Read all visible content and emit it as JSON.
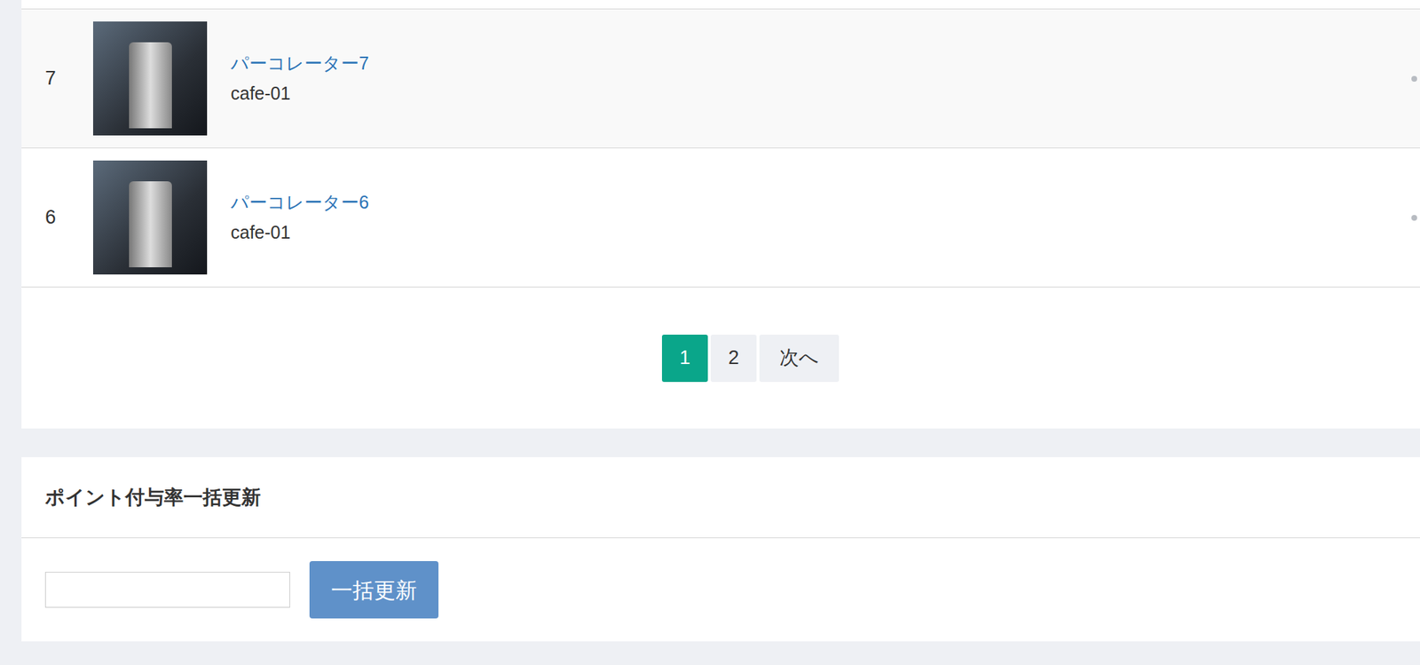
{
  "rows": [
    {
      "number": "7",
      "name": "パーコレーター7",
      "code": "cafe-01",
      "hovered": true
    },
    {
      "number": "6",
      "name": "パーコレーター6",
      "code": "cafe-01",
      "hovered": false
    }
  ],
  "pagination": {
    "pages": [
      {
        "label": "1",
        "selected": true
      },
      {
        "label": "2",
        "selected": false
      }
    ],
    "next": "次へ"
  },
  "bulk_update": {
    "title": "ポイント付与率一括更新",
    "input_value": "",
    "button": "一括更新"
  }
}
